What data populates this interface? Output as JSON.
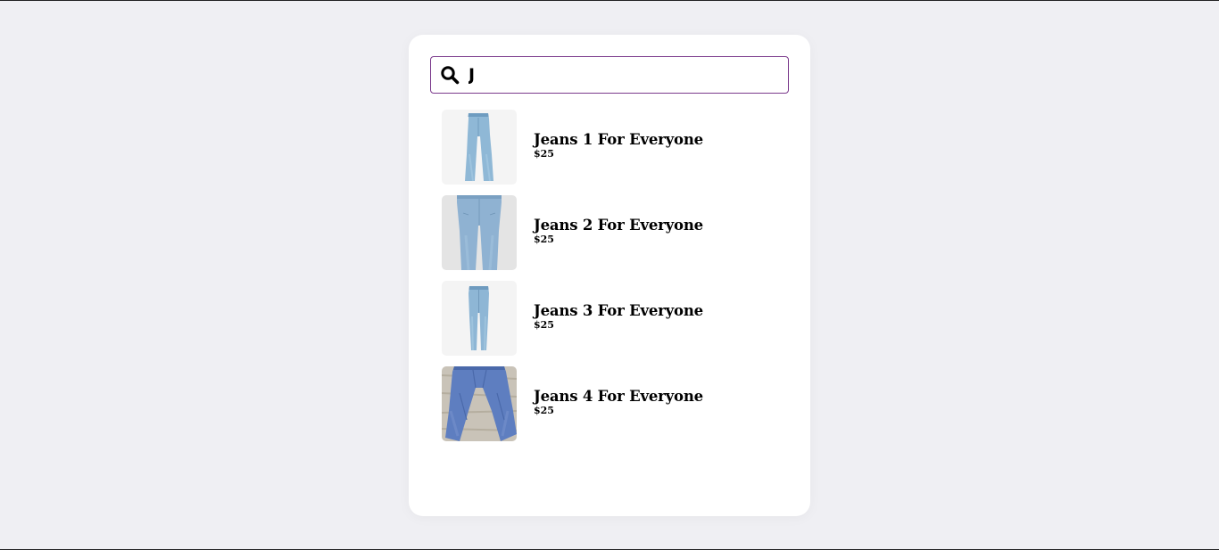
{
  "search": {
    "value": "J",
    "icon": "search-icon",
    "border_color": "#7b3a8c"
  },
  "results": [
    {
      "name": "Jeans 1 For Everyone",
      "price": "$25",
      "image": "jeans-1-image"
    },
    {
      "name": "Jeans 2 For Everyone",
      "price": "$25",
      "image": "jeans-2-image"
    },
    {
      "name": "Jeans 3 For Everyone",
      "price": "$25",
      "image": "jeans-3-image"
    },
    {
      "name": "Jeans 4 For Everyone",
      "price": "$25",
      "image": "jeans-4-image"
    }
  ],
  "colors": {
    "page_background": "#efeff3",
    "card_background": "#ffffff",
    "text": "#000000"
  }
}
